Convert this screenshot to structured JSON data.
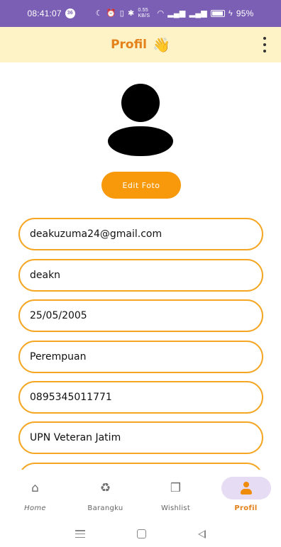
{
  "status_bar": {
    "time": "08:41:07",
    "notification_badge": "36",
    "net_speed": "0.55 KB/S",
    "battery": "95%"
  },
  "app_bar": {
    "title": "Profil",
    "wave_emoji": "👋"
  },
  "profile": {
    "edit_photo_label": "Edit Foto",
    "fields": {
      "email": "deakuzuma24@gmail.com",
      "username": "deakn",
      "birth_date": "25/05/2005",
      "gender": "Perempuan",
      "phone": "0895345011771",
      "institution": "UPN Veteran Jatim"
    }
  },
  "bottom_nav": {
    "active": "profil",
    "items": [
      {
        "label": "Home",
        "icon": "home-icon"
      },
      {
        "label": "Barangku",
        "icon": "recycle-icon"
      },
      {
        "label": "Wishlist",
        "icon": "gift-icon"
      },
      {
        "label": "Profil",
        "icon": "person-icon"
      }
    ]
  },
  "colors": {
    "status_bar": "#7b5fb4",
    "app_bar": "#fdf3c6",
    "accent": "#f7990b",
    "field_border": "#f5a623",
    "active_nav_bg": "#e6dcf4"
  }
}
